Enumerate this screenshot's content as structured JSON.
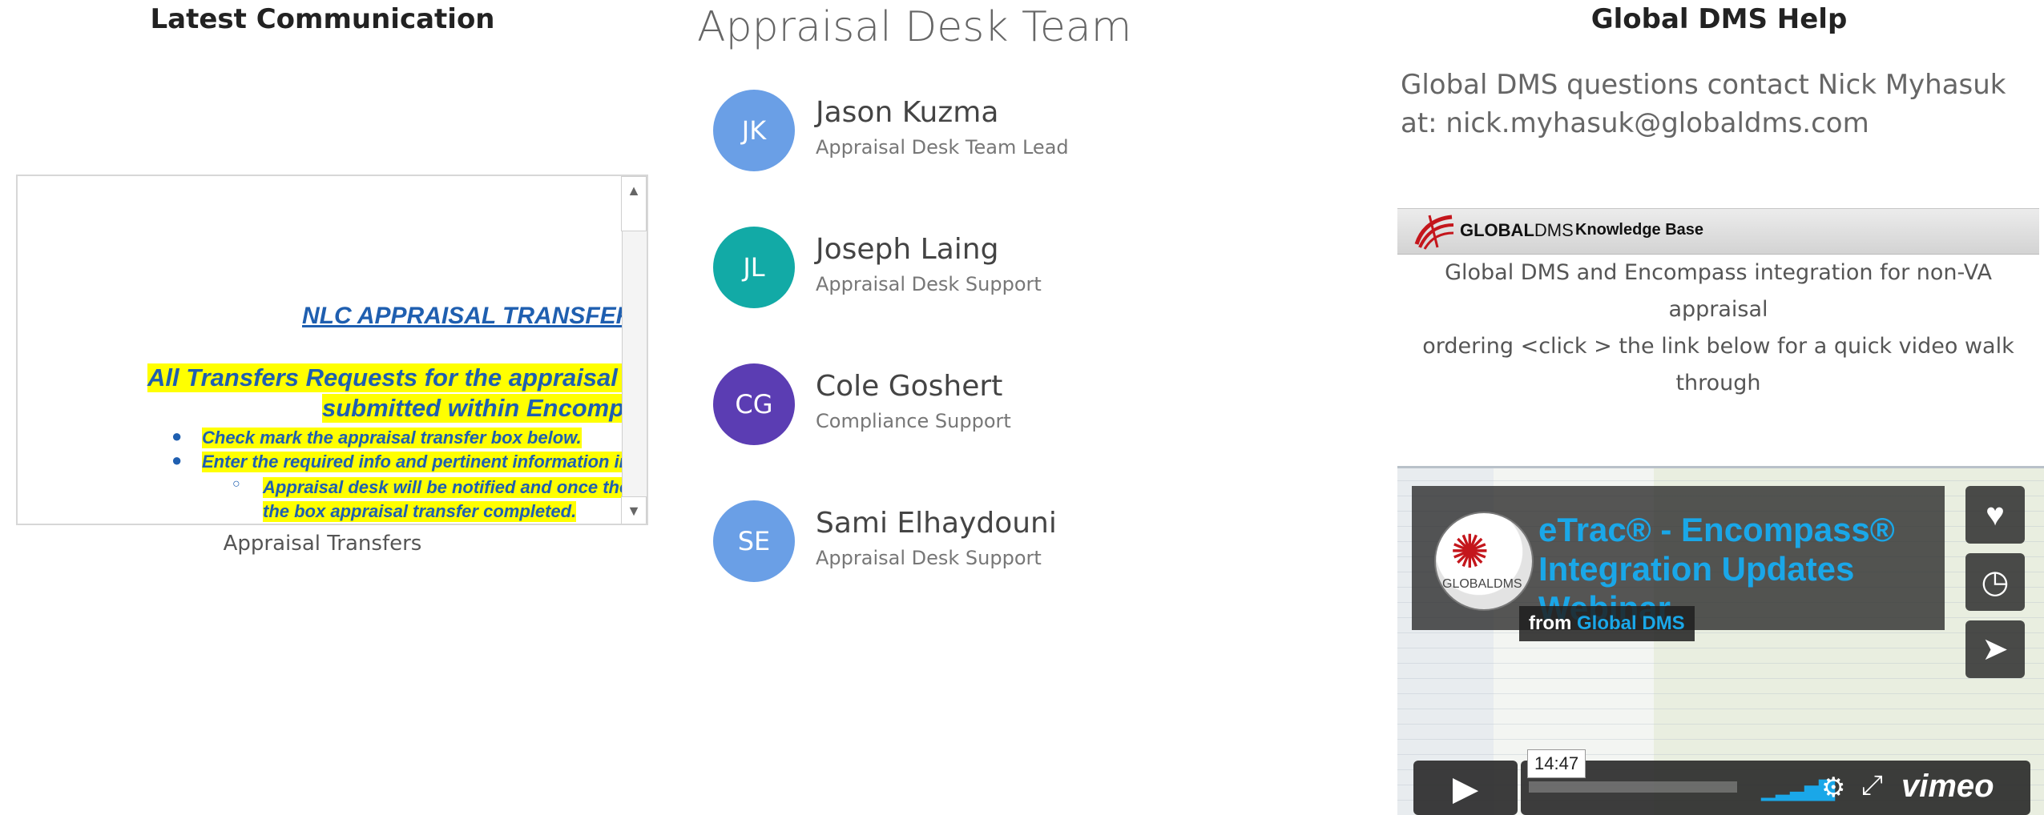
{
  "left": {
    "heading": "Latest Communication",
    "doc": {
      "title": "NLC APPRAISAL TRANSFER",
      "line1": "All Transfers Requests for the appraisal desi",
      "line2": "submitted within Encompas",
      "bullets": [
        "Check mark the appraisal transfer box below.",
        "Enter the required info and pertinent information in th"
      ],
      "sub_bullet_line1": "Appraisal desk will be notified and once the t",
      "sub_bullet_line2": "the box appraisal transfer completed."
    },
    "caption": "Appraisal Transfers"
  },
  "mid": {
    "title": "Appraisal Desk Team",
    "members": [
      {
        "initials": "JK",
        "name": "Jason Kuzma",
        "role": "Appraisal Desk Team Lead",
        "color": "#6a9fe6"
      },
      {
        "initials": "JL",
        "name": "Joseph Laing",
        "role": "Appraisal Desk Support",
        "color": "#12aaa6"
      },
      {
        "initials": "CG",
        "name": "Cole Goshert",
        "role": "Compliance Support",
        "color": "#5b3db3"
      },
      {
        "initials": "SE",
        "name": "Sami Elhaydouni",
        "role": "Appraisal Desk Support",
        "color": "#6a9fe6"
      }
    ]
  },
  "right": {
    "heading": "Global DMS Help",
    "contact_line1": "Global DMS questions contact Nick Myhasuk",
    "contact_line2": "at: nick.myhasuk@globaldms.com",
    "kb_banner": {
      "logo_bold": "GLOBAL",
      "logo_thin": "DMS",
      "title": "Knowledge Base"
    },
    "kb_desc_line1": "Global DMS and Encompass integration for non-VA appraisal",
    "kb_desc_line2": "ordering <click > the link below for a quick video walk through",
    "video": {
      "logo_text": "GLOBALDMS",
      "title": "eTrac® - Encompass® Integration Updates Webinar",
      "from_label": "from",
      "from_name": "Global DMS",
      "duration": "14:47",
      "brand": "vimeo"
    }
  }
}
